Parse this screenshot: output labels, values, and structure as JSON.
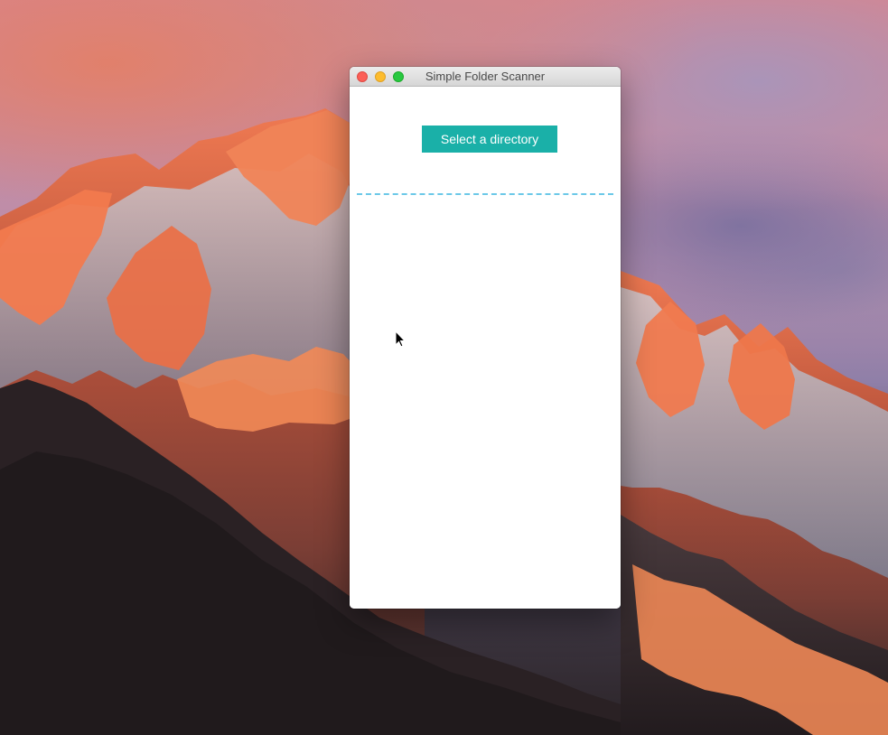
{
  "window": {
    "title": "Simple Folder Scanner"
  },
  "content": {
    "select_button_label": "Select a directory"
  },
  "colors": {
    "button_background": "#1ab0a8",
    "button_text": "#ffffff",
    "divider": "#6bc8e8",
    "close_button": "#fc5f57",
    "minimize_button": "#fdbc2e",
    "maximize_button": "#28c840"
  }
}
